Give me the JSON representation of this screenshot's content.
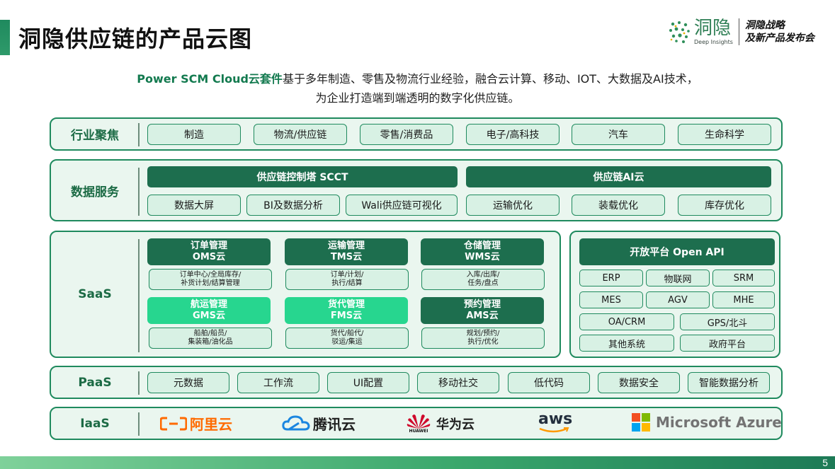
{
  "header": {
    "title": "洞隐供应链的产品云图",
    "logo_cn": "洞隐",
    "logo_en": "Deep Insights",
    "event_line1": "洞隐战略",
    "event_line2": "及新产品发布会"
  },
  "intro": {
    "highlight": "Power SCM Cloud云套件",
    "line1_rest": "基于多年制造、零售及物流行业经验，融合云计算、移动、IOT、大数据及AI技术，",
    "line2": "为企业打造端到端透明的数字化供应链。"
  },
  "industry": {
    "label": "行业聚焦",
    "items": [
      "制造",
      "物流/供应链",
      "零售/消费品",
      "电子/高科技",
      "汽车",
      "生命科学"
    ]
  },
  "data_services": {
    "label": "数据服务",
    "bar_left": "供应链控制塔 SCCT",
    "bar_right": "供应链AI云",
    "items": [
      "数据大屏",
      "BI及数据分析",
      "Wali供应链可视化",
      "运输优化",
      "装载优化",
      "库存优化"
    ]
  },
  "saas": {
    "label": "SaaS",
    "modules": [
      {
        "name": "订单管理",
        "code": "OMS云",
        "desc1": "订单中心/全局库存/",
        "desc2": "补货计划/结算管理"
      },
      {
        "name": "运输管理",
        "code": "TMS云",
        "desc1": "订单/计划/",
        "desc2": "执行/结算"
      },
      {
        "name": "仓储管理",
        "code": "WMS云",
        "desc1": "入库/出库/",
        "desc2": "任务/盘点"
      },
      {
        "name": "航运管理",
        "code": "GMS云",
        "desc1": "船舶/船员/",
        "desc2": "集装箱/油化品"
      },
      {
        "name": "货代管理",
        "code": "FMS云",
        "desc1": "货代/船代/",
        "desc2": "驳运/集运"
      },
      {
        "name": "预约管理",
        "code": "AMS云",
        "desc1": "规划/预约/",
        "desc2": "执行/优化"
      }
    ],
    "open_api": {
      "title": "开放平台 Open API",
      "items": [
        "ERP",
        "物联网",
        "SRM",
        "MES",
        "AGV",
        "MHE",
        "OA/CRM",
        "GPS/北斗",
        "其他系统",
        "政府平台"
      ]
    }
  },
  "paas": {
    "label": "PaaS",
    "items": [
      "元数据",
      "工作流",
      "UI配置",
      "移动社交",
      "低代码",
      "数据安全",
      "智能数据分析"
    ]
  },
  "iaas": {
    "label": "IaaS",
    "providers": [
      "阿里云",
      "腾讯云",
      "华为云",
      "aws",
      "Microsoft Azure"
    ],
    "huawei_sub": "HUAWEI"
  },
  "footer": {
    "page": "5"
  },
  "colors": {
    "primary": "#1f8a5e",
    "dark": "#1d6e4e",
    "light_accent": "#27d68f",
    "panel_bg": "#eaf6ef",
    "chip_bg": "#d8f1e4",
    "aliyun": "#ff6a00",
    "tencent": "#1a86e0",
    "huawei": "#cf0a2c",
    "aws": "#232f3e"
  }
}
